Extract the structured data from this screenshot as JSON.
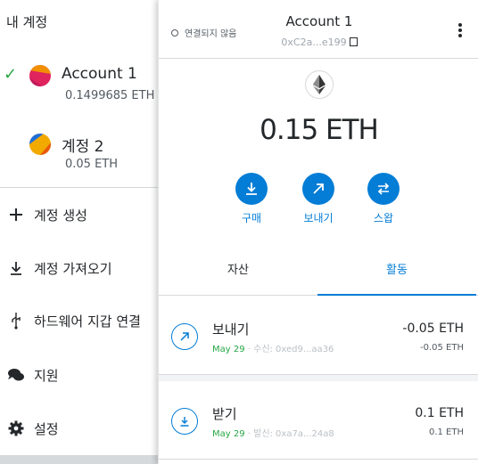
{
  "menu": {
    "title": "내 계정",
    "accounts": [
      {
        "name": "Account 1",
        "balance": "0.1499685 ETH",
        "selected": true
      },
      {
        "name": "계정 2",
        "balance": "0.05 ETH",
        "selected": false
      }
    ],
    "items": [
      {
        "label": "계정 생성",
        "icon": "plus-icon"
      },
      {
        "label": "계정 가져오기",
        "icon": "import-icon"
      },
      {
        "label": "하드웨어 지갑 연결",
        "icon": "usb-icon"
      },
      {
        "label": "지원",
        "icon": "chat-icon"
      },
      {
        "label": "설정",
        "icon": "gear-icon"
      }
    ]
  },
  "popup": {
    "connection_status": "연결되지 않음",
    "account_name": "Account 1",
    "account_address": "0xC2a...e199",
    "balance": "0.15 ETH",
    "actions": [
      {
        "label": "구매",
        "icon": "buy-icon"
      },
      {
        "label": "보내기",
        "icon": "send-icon"
      },
      {
        "label": "스왑",
        "icon": "swap-icon"
      }
    ],
    "tabs": [
      {
        "label": "자산",
        "active": false
      },
      {
        "label": "활동",
        "active": true
      }
    ],
    "transactions": [
      {
        "title": "보내기",
        "date": "May 29",
        "detail": " · 수신: 0xed9...aa36",
        "amount": "-0.05 ETH",
        "amount_secondary": "-0.05 ETH",
        "icon": "send-icon"
      },
      {
        "title": "받기",
        "date": "May 29",
        "detail": " · 발신: 0xa7a...24a8",
        "amount": "0.1 ETH",
        "amount_secondary": "0.1 ETH",
        "icon": "receive-icon"
      }
    ]
  },
  "colors": {
    "accent": "#037dd6",
    "success": "#28a745",
    "text": "#24272a",
    "muted": "#9fa6ae"
  }
}
